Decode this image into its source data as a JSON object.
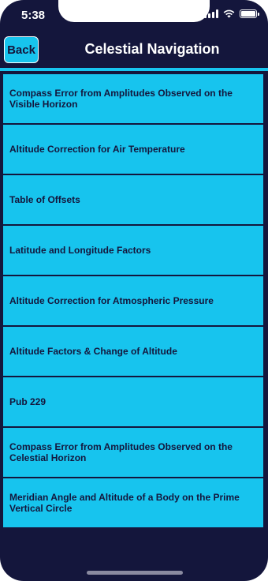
{
  "status_bar": {
    "time": "5:38",
    "icons": [
      "signal-icon",
      "wifi-icon",
      "battery-icon"
    ]
  },
  "nav": {
    "back_label": "Back",
    "title": "Celestial Navigation"
  },
  "colors": {
    "background": "#14163c",
    "accent": "#17c4ee",
    "item_text": "#14163c",
    "title_text": "#ffffff"
  },
  "items": [
    {
      "label": "Compass Error from Amplitudes Observed on the Visible Horizon"
    },
    {
      "label": "Altitude Correction for Air Temperature"
    },
    {
      "label": "Table of Offsets"
    },
    {
      "label": "Latitude and Longitude Factors"
    },
    {
      "label": "Altitude Correction for Atmospheric Pressure"
    },
    {
      "label": "Altitude Factors & Change of Altitude"
    },
    {
      "label": "Pub 229"
    },
    {
      "label": "Compass Error from Amplitudes Observed on the Celestial Horizon"
    },
    {
      "label": "Meridian Angle and Altitude of a Body on the Prime Vertical Circle"
    }
  ]
}
